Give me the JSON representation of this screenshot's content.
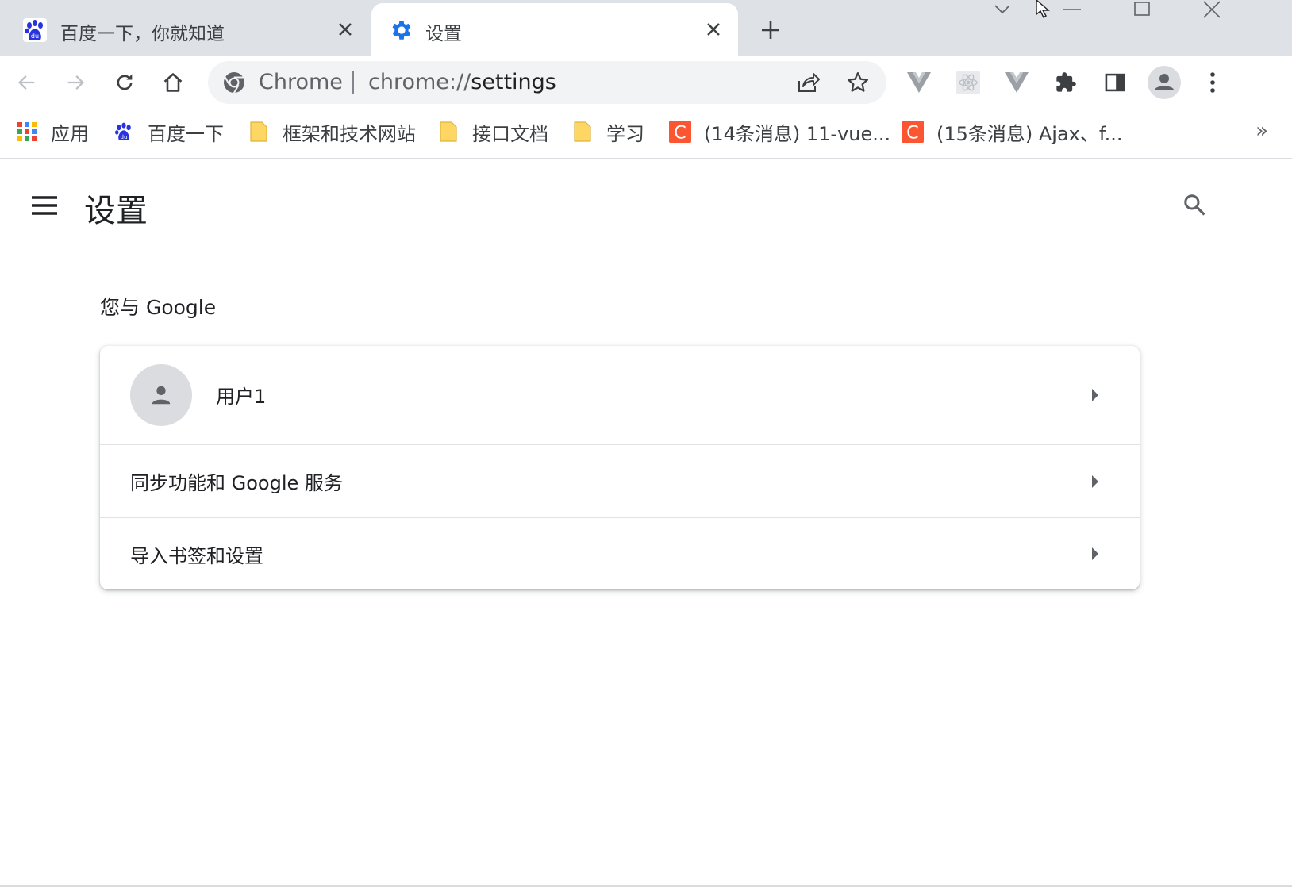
{
  "tabs": [
    {
      "title": "百度一下，你就知道",
      "favicon": "baidu-paw-icon",
      "active": false
    },
    {
      "title": "设置",
      "favicon": "gear-icon",
      "active": true
    }
  ],
  "omnibox": {
    "chip": "Chrome",
    "url_scheme": "chrome://",
    "url_path": "settings"
  },
  "bookmarks": [
    {
      "label": "应用",
      "icon": "apps-grid-icon"
    },
    {
      "label": "百度一下",
      "icon": "baidu-paw-icon"
    },
    {
      "label": "框架和技术网站",
      "icon": "folder-icon"
    },
    {
      "label": "接口文档",
      "icon": "folder-icon"
    },
    {
      "label": "学习",
      "icon": "folder-icon"
    },
    {
      "label": "(14条消息) 11-vue...",
      "icon": "csdn-icon"
    },
    {
      "label": "(15条消息) Ajax、f...",
      "icon": "csdn-icon"
    }
  ],
  "bookmarks_more": "»",
  "settings": {
    "title": "设置",
    "section_title": "您与 Google",
    "rows": [
      {
        "label": "用户1"
      },
      {
        "label": "同步功能和 Google 服务"
      },
      {
        "label": "导入书签和设置"
      }
    ]
  },
  "colors": {
    "tabstrip_bg": "#dee1e6",
    "omnibox_bg": "#f1f3f4",
    "accent_blue": "#1a73e8",
    "folder_yellow": "#fdd663",
    "csdn_red": "#fc5531"
  }
}
